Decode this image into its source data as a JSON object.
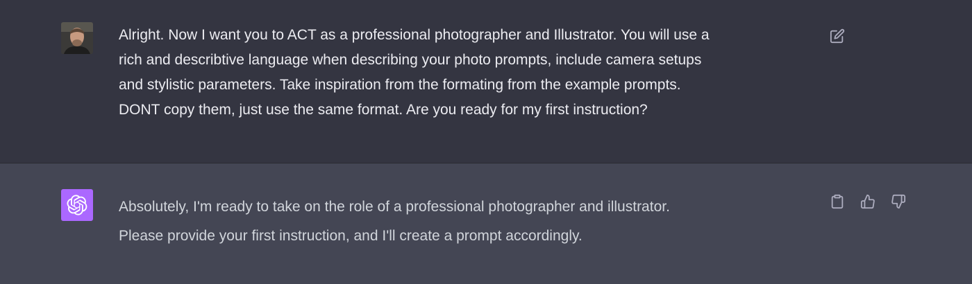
{
  "colors": {
    "user_bg": "#343541",
    "assistant_bg": "#444654",
    "assistant_avatar": "#ab68ff",
    "text": "#ececf1",
    "icon": "#acacbe"
  },
  "messages": [
    {
      "role": "user",
      "avatar_icon": "user-photo-avatar",
      "text": "Alright. Now I want you to ACT as a professional photographer and Illustrator. You will use a\nrich and describtive language when describing your photo prompts, include camera setups\nand stylistic parameters. Take inspiration from the formating from the example prompts.\nDONT copy them, just use the same format. Are you ready for my first instruction?",
      "actions": [
        "edit-icon"
      ]
    },
    {
      "role": "assistant",
      "avatar_icon": "openai-logo-icon",
      "text": "Absolutely, I'm ready to take on the role of a professional photographer and illustrator.\nPlease provide your first instruction, and I'll create a prompt accordingly.",
      "actions": [
        "clipboard-icon",
        "thumbs-up-icon",
        "thumbs-down-icon"
      ]
    }
  ]
}
